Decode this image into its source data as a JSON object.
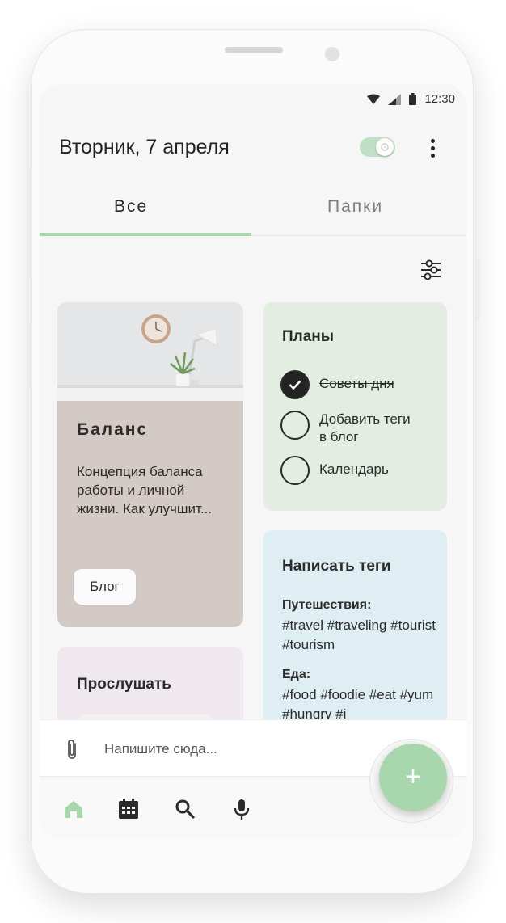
{
  "status_bar": {
    "time": "12:30"
  },
  "header": {
    "title": "Вторник, 7 апреля"
  },
  "tabs": [
    {
      "label": "Все",
      "active": true
    },
    {
      "label": "Папки",
      "active": false
    }
  ],
  "cards": {
    "balance": {
      "title": "Баланс",
      "text": "Концепция баланса работы и личной жизни. Как улучшит...",
      "tag": "Блог"
    },
    "plans": {
      "title": "Планы",
      "items": [
        {
          "label": "Советы дня",
          "done": true
        },
        {
          "label": "Добавить теги в блог",
          "done": false
        },
        {
          "label": "Календарь",
          "done": false
        }
      ]
    },
    "tags": {
      "title": "Написать теги",
      "groups": [
        {
          "name": "Путешествия:",
          "tags": "#travel #traveling #tourist #tourism"
        },
        {
          "name": "Еда:",
          "tags": "#food #foodie #eat #yum #hungry #i"
        }
      ]
    },
    "listen": {
      "title": "Прослушать"
    }
  },
  "composer": {
    "placeholder": "Напишите сюда..."
  },
  "fab": {
    "label": "+"
  },
  "colors": {
    "accent": "#a9d7ad",
    "balance_card": "#d4cac5",
    "plans_card": "#e3ede2",
    "tags_card": "#deeef2",
    "listen_card": "#efe8ef"
  },
  "icons": [
    "wifi-icon",
    "signal-icon",
    "battery-icon",
    "theme-toggle-icon",
    "more-vert-icon",
    "filter-icon",
    "paperclip-icon",
    "home-icon",
    "calendar-icon",
    "search-icon",
    "mic-icon",
    "plus-icon",
    "check-icon"
  ]
}
